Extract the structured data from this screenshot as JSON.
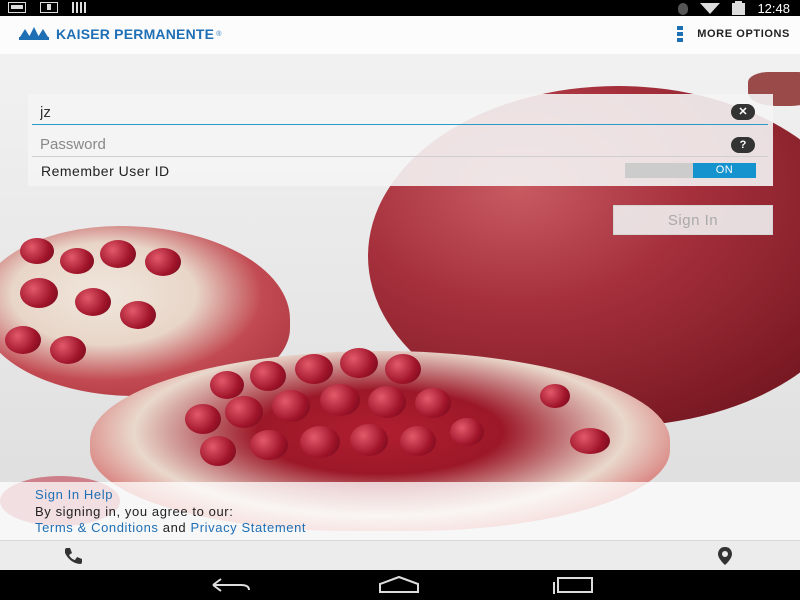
{
  "status_bar": {
    "time": "12:48",
    "left_icons": [
      "message-icon",
      "download-icon",
      "signal-bars-icon"
    ],
    "right_icons": [
      "bluetooth-icon",
      "wifi-icon",
      "battery-icon"
    ]
  },
  "header": {
    "logo_text": "KAISER PERMANENTE",
    "logo_reg": "®",
    "more_options_label": "MORE OPTIONS"
  },
  "login": {
    "user_id_value": "jz",
    "password_placeholder": "Password",
    "clear_icon_glyph": "✕",
    "help_icon_glyph": "?",
    "remember_label": "Remember User ID",
    "toggle_state": "ON",
    "sign_in_label": "Sign In"
  },
  "footer": {
    "sign_in_help": "Sign In Help",
    "agree_text": "By signing in, you agree to our:",
    "terms_link": "Terms & Conditions",
    "and_text": "and",
    "privacy_link": "Privacy Statement"
  },
  "bottom_bar": {
    "icons": [
      "phone-icon",
      "location-icon"
    ]
  },
  "nav_bar": {
    "buttons": [
      "back-icon",
      "home-icon",
      "recent-apps-icon"
    ]
  },
  "colors": {
    "brand_blue": "#1f6fb5",
    "toggle_on": "#1593cf",
    "input_underline": "#2a9ac8"
  }
}
